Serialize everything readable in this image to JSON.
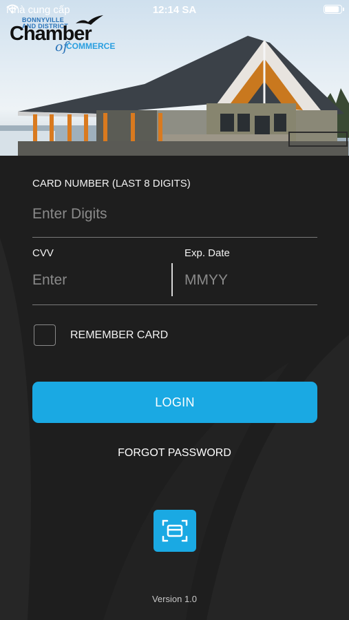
{
  "status_bar": {
    "carrier": "Nhà cung cấp",
    "time": "12:14 SA"
  },
  "logo": {
    "line1": "BONNYVILLE",
    "line2": "AND DISTRICT",
    "name": "Chamber",
    "of": "of",
    "commerce": "COMMERCE"
  },
  "form": {
    "card_number_label": "CARD NUMBER (LAST 8 DIGITS)",
    "card_number_placeholder": "Enter Digits",
    "cvv_label": "CVV",
    "cvv_placeholder": "Enter",
    "exp_label": "Exp. Date",
    "exp_placeholder": "MMYY",
    "remember_label": "REMEMBER CARD",
    "remember_checked": false
  },
  "actions": {
    "login_label": "LOGIN",
    "forgot_label": "FORGOT PASSWORD"
  },
  "scan_button": {
    "icon": "card-scan-icon"
  },
  "footer": {
    "version": "Version  1.0"
  },
  "colors": {
    "accent": "#1aa9e3",
    "background": "#1e1e1e",
    "placeholder": "#8a8a8a"
  }
}
